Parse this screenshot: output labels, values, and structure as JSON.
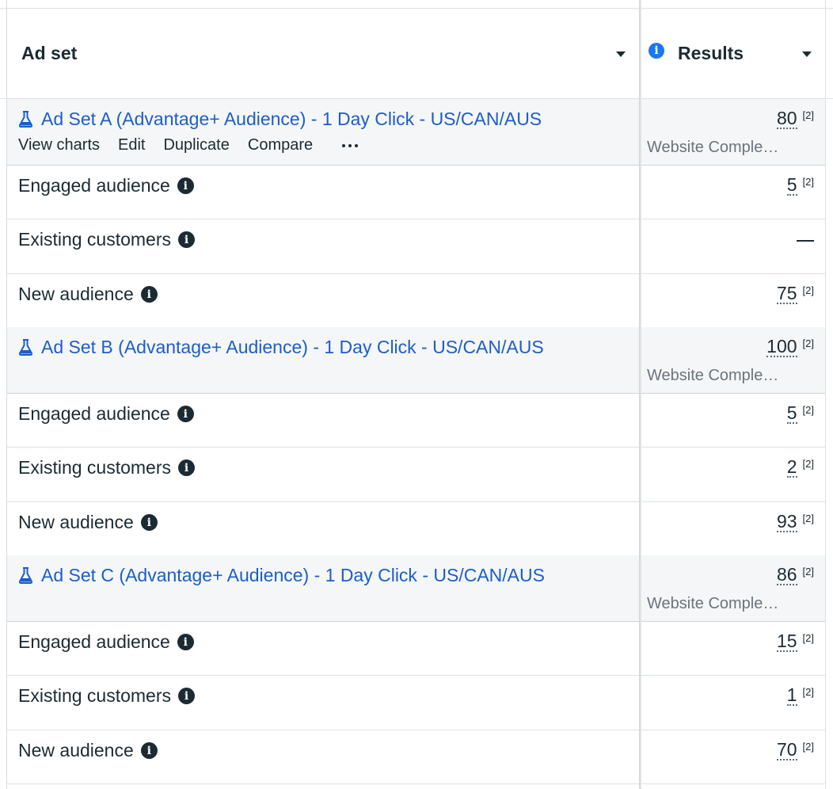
{
  "header": {
    "adset_label": "Ad set",
    "results_label": "Results",
    "results_info_icon": "info-icon"
  },
  "colors": {
    "link": "#1c5ec9",
    "parent_row_bg": "#f5f6f7",
    "text": "#1c2b33",
    "info_header": "#1877f2"
  },
  "groups": [
    {
      "name": "Ad Set A (Advantage+ Audience) - 1 Day Click - US/CAN/AUS",
      "icon": "flask-icon",
      "actions": [
        "View charts",
        "Edit",
        "Duplicate",
        "Compare"
      ],
      "result": "80",
      "result_note": "[2]",
      "result_type": "Website Comple…",
      "children": [
        {
          "label": "Engaged audience",
          "result": "5",
          "note": "[2]"
        },
        {
          "label": "Existing customers",
          "result": "—",
          "note": ""
        },
        {
          "label": "New audience",
          "result": "75",
          "note": "[2]"
        }
      ]
    },
    {
      "name": "Ad Set B (Advantage+ Audience) - 1 Day Click - US/CAN/AUS",
      "icon": "flask-icon",
      "result": "100",
      "result_note": "[2]",
      "result_type": "Website Comple…",
      "children": [
        {
          "label": "Engaged audience",
          "result": "5",
          "note": "[2]"
        },
        {
          "label": "Existing customers",
          "result": "2",
          "note": "[2]"
        },
        {
          "label": "New audience",
          "result": "93",
          "note": "[2]"
        }
      ]
    },
    {
      "name": "Ad Set C (Advantage+ Audience) - 1 Day Click - US/CAN/AUS",
      "icon": "flask-icon",
      "result": "86",
      "result_note": "[2]",
      "result_type": "Website Comple…",
      "children": [
        {
          "label": "Engaged audience",
          "result": "15",
          "note": "[2]"
        },
        {
          "label": "Existing customers",
          "result": "1",
          "note": "[2]"
        },
        {
          "label": "New audience",
          "result": "70",
          "note": "[2]"
        }
      ]
    }
  ]
}
